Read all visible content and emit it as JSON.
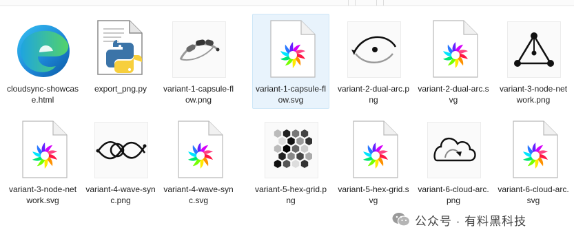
{
  "files": [
    {
      "name": "cloudsync-showcase.html",
      "type": "edge-html",
      "icon": "edge-browser-icon"
    },
    {
      "name": "export_png.py",
      "type": "python",
      "icon": "python-file-icon"
    },
    {
      "name": "variant-1-capsule-flow.png",
      "type": "png-capsule",
      "icon": "capsule-flow-thumbnail"
    },
    {
      "name": "variant-1-capsule-flow.svg",
      "type": "svg",
      "icon": "svg-file-icon",
      "selected": true
    },
    {
      "name": "variant-2-dual-arc.png",
      "type": "png-dualarc",
      "icon": "dual-arc-thumbnail"
    },
    {
      "name": "variant-2-dual-arc.svg",
      "type": "svg",
      "icon": "svg-file-icon"
    },
    {
      "name": "variant-3-node-network.png",
      "type": "png-network",
      "icon": "node-network-thumbnail"
    },
    {
      "name": "variant-3-node-network.svg",
      "type": "svg",
      "icon": "svg-file-icon"
    },
    {
      "name": "variant-4-wave-sync.png",
      "type": "png-wave",
      "icon": "wave-sync-thumbnail"
    },
    {
      "name": "variant-4-wave-sync.svg",
      "type": "svg",
      "icon": "svg-file-icon"
    },
    {
      "name": "variant-5-hex-grid.png",
      "type": "png-hex",
      "icon": "hex-grid-thumbnail"
    },
    {
      "name": "variant-5-hex-grid.svg",
      "type": "svg",
      "icon": "svg-file-icon"
    },
    {
      "name": "variant-6-cloud-arc.png",
      "type": "png-cloud",
      "icon": "cloud-arc-thumbnail"
    },
    {
      "name": "variant-6-cloud-arc.svg",
      "type": "svg",
      "icon": "svg-file-icon"
    }
  ],
  "watermark": {
    "text": "公众号 · 有料黑科技",
    "icon": "wechat-icon"
  },
  "colors": {
    "selection_bg": "#e8f3fc",
    "selection_border": "#cde6f7"
  }
}
